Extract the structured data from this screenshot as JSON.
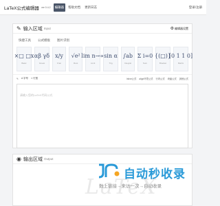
{
  "nav": {
    "brand": "LaTeX公式编辑器",
    "version": "ver 0.4.2",
    "links": [
      "编辑器",
      "帮助文档",
      "更新日志"
    ],
    "right": "登录/注册"
  },
  "input_card": {
    "icon": "edit-icon",
    "title": "输入区域",
    "subtitle": "Input",
    "settings_label": "编辑器设置",
    "tabs": [
      "快捷工具",
      "公式模板",
      "图片识别"
    ],
    "templates": [
      {
        "symbol": "×□ □x",
        "label": "Basic"
      },
      {
        "symbol": "αβ γδ",
        "label": "Greek"
      },
      {
        "symbol": "x/y",
        "label": "Frac"
      },
      {
        "symbol": "√e²",
        "label": "Root"
      },
      {
        "symbol": "lim n→∞",
        "label": "Limit"
      },
      {
        "symbol": "sin α",
        "label": "Trig"
      },
      {
        "symbol": "∫ab",
        "label": "Integral"
      },
      {
        "symbol": "Σ i=0",
        "label": "Sum"
      },
      {
        "symbol": "{(□)}",
        "label": "Bracket"
      },
      {
        "symbol": "[0 1 1 0]",
        "label": "Matrix"
      }
    ],
    "toolbar": [
      "✎",
      "A 字号",
      "≡ 行宽"
    ],
    "toolbar_right": [
      "Inline公式",
      "align环境公式",
      "行内公式",
      "块级公式",
      "其他公式"
    ],
    "editor_placeholder": "请输入您的LaTeX代码公式"
  },
  "output_card": {
    "icon": "output-icon",
    "title": "输出区域",
    "subtitle": "Output",
    "watermark": "LaTeX"
  },
  "ad": {
    "title": "自动秒收录",
    "slogan": "数上链接→来访一次→自动收录"
  }
}
